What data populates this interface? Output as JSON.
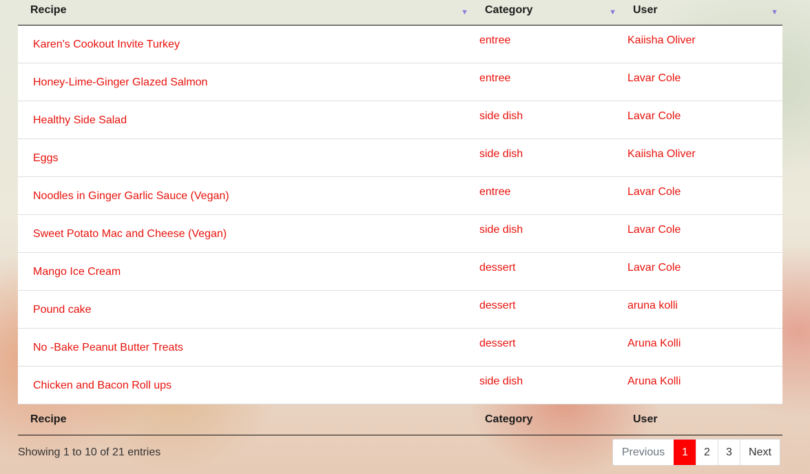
{
  "table": {
    "headers": {
      "recipe": "Recipe",
      "category": "Category",
      "user": "User"
    },
    "sort_icon": "triangle-down-icon",
    "rows": [
      {
        "recipe": "Karen's Cookout Invite Turkey",
        "category": "entree",
        "user": "Kaiisha Oliver"
      },
      {
        "recipe": "Honey-Lime-Ginger Glazed Salmon",
        "category": "entree",
        "user": "Lavar Cole"
      },
      {
        "recipe": "Healthy Side Salad",
        "category": "side dish",
        "user": "Lavar Cole"
      },
      {
        "recipe": "Eggs",
        "category": "side dish",
        "user": "Kaiisha Oliver"
      },
      {
        "recipe": "Noodles in Ginger Garlic Sauce (Vegan)",
        "category": "entree",
        "user": "Lavar Cole"
      },
      {
        "recipe": "Sweet Potato Mac and Cheese (Vegan)",
        "category": "side dish",
        "user": "Lavar Cole"
      },
      {
        "recipe": "Mango Ice Cream",
        "category": "dessert",
        "user": "Lavar Cole"
      },
      {
        "recipe": "Pound cake",
        "category": "dessert",
        "user": "aruna kolli"
      },
      {
        "recipe": "No -Bake Peanut Butter Treats",
        "category": "dessert",
        "user": "Aruna Kolli"
      },
      {
        "recipe": "Chicken and Bacon Roll ups",
        "category": "side dish",
        "user": "Aruna Kolli"
      }
    ],
    "footers": {
      "recipe": "Recipe",
      "category": "Category",
      "user": "User"
    }
  },
  "info": "Showing 1 to 10 of 21 entries",
  "pagination": {
    "previous": "Previous",
    "pages": [
      "1",
      "2",
      "3"
    ],
    "current": "1",
    "next": "Next"
  },
  "colors": {
    "link": "#e8120c",
    "active_page": "#ff0000",
    "sort_icon": "#8a7cd8"
  }
}
